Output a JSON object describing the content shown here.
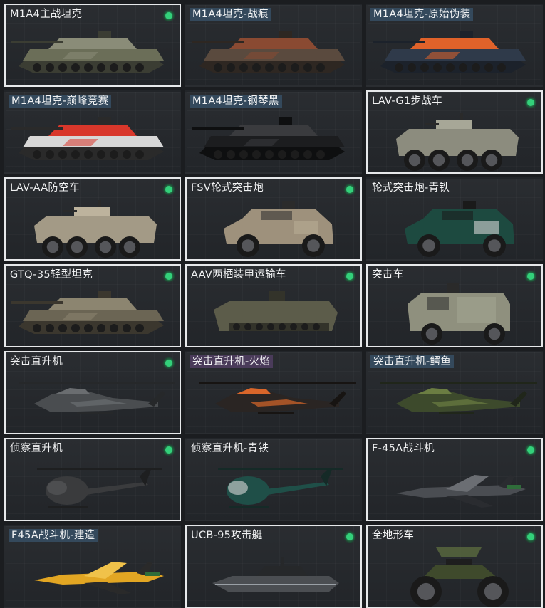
{
  "vehicles": [
    {
      "name": "M1A4主战坦克",
      "owned": true,
      "kind": "tank",
      "colors": {
        "hull": "#6b6e58",
        "dark": "#3b3d33",
        "accent": "#8a8c78"
      }
    },
    {
      "name": "M1A4坦克-战痕",
      "owned": false,
      "tag_color": "#34495c",
      "kind": "tank",
      "colors": {
        "hull": "#5a4a3e",
        "dark": "#2e2722",
        "accent": "#8a4a32"
      }
    },
    {
      "name": "M1A4坦克-原始伪装",
      "owned": false,
      "tag_color": "#34495c",
      "kind": "tank",
      "colors": {
        "hull": "#2f3a4a",
        "dark": "#1c222b",
        "accent": "#e0622a"
      }
    },
    {
      "name": "M1A4坦克-巅峰竞赛",
      "owned": false,
      "tag_color": "#34495c",
      "kind": "tank",
      "colors": {
        "hull": "#d7d7d7",
        "dark": "#2a2a2a",
        "accent": "#d8372b"
      }
    },
    {
      "name": "M1A4坦克-钢琴黑",
      "owned": false,
      "tag_color": "#34495c",
      "kind": "tank",
      "colors": {
        "hull": "#1c1d1f",
        "dark": "#0e0f10",
        "accent": "#3a3b3e"
      }
    },
    {
      "name": "LAV-G1步战车",
      "owned": true,
      "kind": "apc",
      "colors": {
        "hull": "#8c8c7e",
        "dark": "#2a2a2a",
        "accent": "#a7a797"
      }
    },
    {
      "name": "LAV-AA防空车",
      "owned": true,
      "kind": "apc",
      "colors": {
        "hull": "#a39a86",
        "dark": "#2a2a2a",
        "accent": "#bdb39d"
      }
    },
    {
      "name": "FSV轮式突击炮",
      "owned": true,
      "kind": "armoredcar",
      "colors": {
        "hull": "#9e917c",
        "dark": "#2b2b2b",
        "accent": "#b8ab95"
      }
    },
    {
      "name": "轮式突击炮-青铁",
      "owned": false,
      "kind": "armoredcar",
      "colors": {
        "hull": "#1d4a40",
        "dark": "#1a1a1a",
        "accent": "#d7d7d7"
      }
    },
    {
      "name": "GTQ-35轻型坦克",
      "owned": true,
      "kind": "tank",
      "colors": {
        "hull": "#6b6554",
        "dark": "#3b372e",
        "accent": "#8c8570"
      }
    },
    {
      "name": "AAV两栖装甲运输车",
      "owned": true,
      "kind": "amphib",
      "colors": {
        "hull": "#5c5c4a",
        "dark": "#33332a",
        "accent": "#7a7a64"
      }
    },
    {
      "name": "突击车",
      "owned": true,
      "kind": "truck",
      "colors": {
        "hull": "#8f907e",
        "dark": "#2a2a2a",
        "accent": "#a9aa97"
      }
    },
    {
      "name": "突击直升机",
      "owned": true,
      "kind": "attackheli",
      "colors": {
        "hull": "#4a4d50",
        "dark": "#26282a",
        "accent": "#6a6d70"
      }
    },
    {
      "name": "突击直升机-火焰",
      "owned": false,
      "tag_color": "#4a3b5a",
      "kind": "attackheli",
      "colors": {
        "hull": "#2a2523",
        "dark": "#171412",
        "accent": "#d9662a"
      }
    },
    {
      "name": "突击直升机-鳄鱼",
      "owned": false,
      "tag_color": "#34495c",
      "kind": "attackheli",
      "colors": {
        "hull": "#3d4a2c",
        "dark": "#20261a",
        "accent": "#6b7d42"
      }
    },
    {
      "name": "侦察直升机",
      "owned": true,
      "kind": "scoutheli",
      "colors": {
        "hull": "#3a3b3d",
        "dark": "#1e1f20",
        "accent": "#5a5b5e"
      }
    },
    {
      "name": "侦察直升机-青铁",
      "owned": false,
      "kind": "scoutheli",
      "colors": {
        "hull": "#1f4f48",
        "dark": "#152a27",
        "accent": "#d8d8d8"
      }
    },
    {
      "name": "F-45A战斗机",
      "owned": true,
      "kind": "jet",
      "colors": {
        "hull": "#4a4d52",
        "dark": "#2a2c30",
        "accent": "#6b6e73"
      }
    },
    {
      "name": "F45A战斗机-建造",
      "owned": false,
      "tag_color": "#34495c",
      "kind": "jet",
      "colors": {
        "hull": "#e2a623",
        "dark": "#2a2a2a",
        "accent": "#f0c24a"
      }
    },
    {
      "name": "UCB-95攻击艇",
      "owned": true,
      "kind": "boat",
      "colors": {
        "hull": "#4b4e52",
        "dark": "#26282a",
        "accent": "#9aa0a6"
      }
    },
    {
      "name": "全地形车",
      "owned": true,
      "kind": "atv",
      "colors": {
        "hull": "#3f4a2c",
        "dark": "#1e1e1e",
        "accent": "#5a6a3e"
      }
    }
  ]
}
